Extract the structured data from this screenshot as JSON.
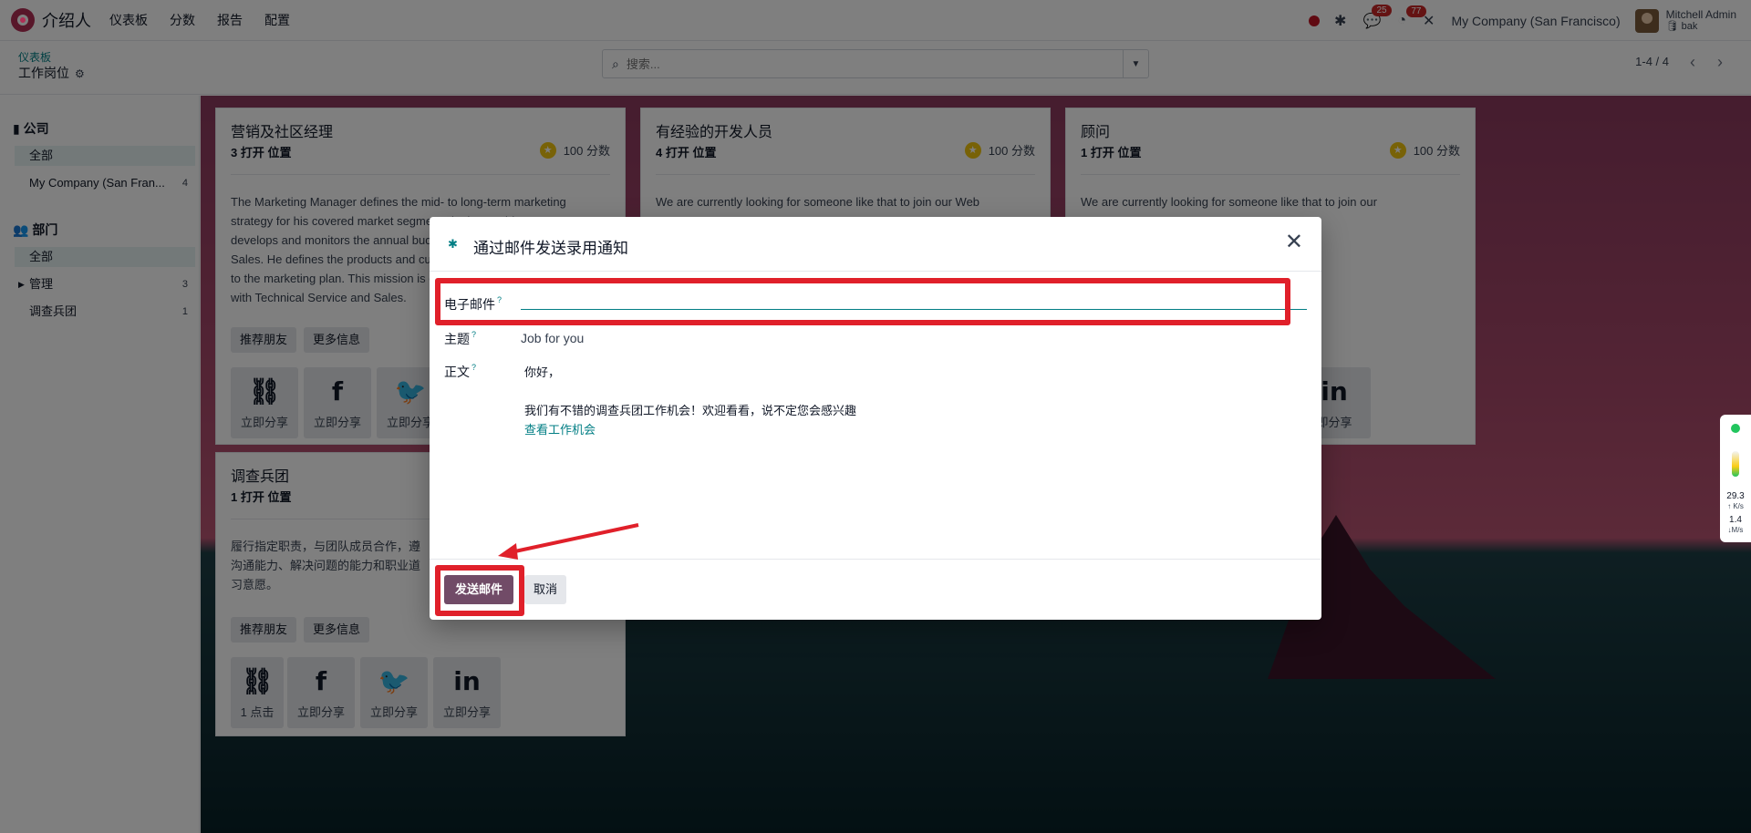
{
  "navbar": {
    "app_name": "介绍人",
    "menu": [
      "仪表板",
      "分数",
      "报告",
      "配置"
    ],
    "messages_badge": "25",
    "activities_badge": "77",
    "company": "My Company (San Francisco)",
    "user_name": "Mitchell Admin",
    "user_db": "bak"
  },
  "control": {
    "breadcrumb": "仪表板",
    "title": "工作岗位",
    "search_placeholder": "搜索...",
    "pager": "1-4 / 4"
  },
  "sidebar": {
    "company_head": "公司",
    "company_items": [
      {
        "label": "全部",
        "count": ""
      },
      {
        "label": "My Company (San Fran...",
        "count": "4"
      }
    ],
    "department_head": "部门",
    "department_items": [
      {
        "label": "全部",
        "count": ""
      },
      {
        "label": "管理",
        "count": "3"
      },
      {
        "label": "调查兵团",
        "count": "1"
      }
    ]
  },
  "cards": [
    {
      "title": "营销及社区经理",
      "openings": "3 打开 位置",
      "score": "100 分数",
      "desc_lines": [
        "The Marketing Manager defines the mid- to long-term marketing",
        "strategy for his covered market segments in the World. He",
        "develops and monitors the annual budget in collaboration with",
        "Sales. He defines the products and customer references",
        "to the marketing plan. This mission is carried out in close",
        "with Technical Service and Sales."
      ],
      "btn_refer": "推荐朋友",
      "btn_more": "更多信息",
      "shares": [
        {
          "glyph": "⛓",
          "label": "立即分享"
        },
        {
          "glyph": "f",
          "label": "立即分享"
        },
        {
          "glyph": "🐦",
          "label": "立即分享"
        }
      ]
    },
    {
      "title": "有经验的开发人员",
      "openings": "4 打开 位置",
      "score": "100 分数",
      "desc_lines": [
        "We are currently looking for someone like that to join our Web"
      ]
    },
    {
      "title": "顾问",
      "openings": "1 打开 位置",
      "score": "100 分数",
      "desc_lines": [
        "We are currently looking for someone like that to join our"
      ],
      "share_partial": {
        "glyph": "in",
        "label": "即分享"
      }
    },
    {
      "title": "调查兵团",
      "openings": "1 打开 位置",
      "desc_lines": [
        "履行指定职责，与团队成员合作，遵",
        "沟通能力、解决问题的能力和职业道",
        "习意愿。"
      ],
      "btn_refer": "推荐朋友",
      "btn_more": "更多信息",
      "shares": [
        {
          "glyph": "⛓",
          "label": "1 点击"
        },
        {
          "glyph": "f",
          "label": "立即分享"
        },
        {
          "glyph": "🐦",
          "label": "立即分享"
        },
        {
          "glyph": "in",
          "label": "立即分享"
        }
      ]
    }
  ],
  "modal": {
    "title": "通过邮件发送录用通知",
    "email_label": "电子邮件",
    "email_value": "",
    "subject_label": "主题",
    "subject_value": "Job for you",
    "body_label": "正文",
    "help_mark": "?",
    "body_greeting": "你好，",
    "body_text": "我们有不错的调查兵团工作机会！欢迎看看，说不定您会感兴趣",
    "body_link": "查看工作机会",
    "send_label": "发送邮件",
    "cancel_label": "取消"
  },
  "widget": {
    "up_value": "29.3",
    "up_unit": "↑ K/s",
    "down_value": "1.4",
    "down_unit": "↓M/s"
  },
  "colors": {
    "accent": "#017e84",
    "primary_button": "#714b67",
    "highlight": "#e0202a"
  }
}
